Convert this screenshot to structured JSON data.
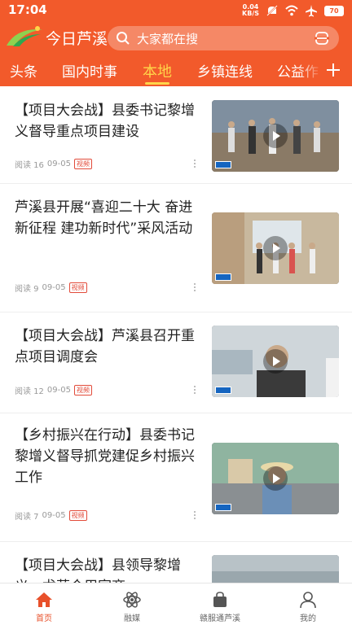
{
  "status_bar": {
    "time": "17:04",
    "net_speed_value": "0.04",
    "net_speed_unit": "KB/S",
    "battery": "70",
    "icons": [
      "mute-icon",
      "wifi-icon",
      "airplane-icon",
      "battery-icon"
    ]
  },
  "header": {
    "app_name": "今日芦溪",
    "search_placeholder": "大家都在搜",
    "accent_color": "#f25a2b",
    "active_tab_color": "#ffd54a"
  },
  "tabs": [
    {
      "label": "头条",
      "active": false
    },
    {
      "label": "国内时事",
      "active": false
    },
    {
      "label": "本地",
      "active": true
    },
    {
      "label": "乡镇连线",
      "active": false
    },
    {
      "label": "公益作",
      "active": false
    }
  ],
  "feed": [
    {
      "title": "【项目大会战】县委书记黎增义督导重点项目建设",
      "reads": "阅读 16",
      "date": "09-05",
      "tag": "视频"
    },
    {
      "title": "芦溪县开展“喜迎二十大 奋进新征程 建功新时代”采风活动",
      "reads": "阅读 9",
      "date": "09-05",
      "tag": "视频"
    },
    {
      "title": "【项目大会战】芦溪县召开重点项目调度会",
      "reads": "阅读 12",
      "date": "09-05",
      "tag": "视频"
    },
    {
      "title": "【乡村振兴在行动】县委书记黎增义督导抓党建促乡村振兴工作",
      "reads": "阅读 7",
      "date": "09-05",
      "tag": "视频"
    },
    {
      "title": "【项目大会战】县领导黎增义、尤芬合用家商",
      "reads": "",
      "date": "",
      "tag": ""
    }
  ],
  "bottom_nav": [
    {
      "label": "首页",
      "icon": "home-icon",
      "active": true
    },
    {
      "label": "融媒",
      "icon": "atom-icon",
      "active": false
    },
    {
      "label": "赣服通芦溪",
      "icon": "bag-icon",
      "active": false
    },
    {
      "label": "我的",
      "icon": "profile-icon",
      "active": false
    }
  ]
}
